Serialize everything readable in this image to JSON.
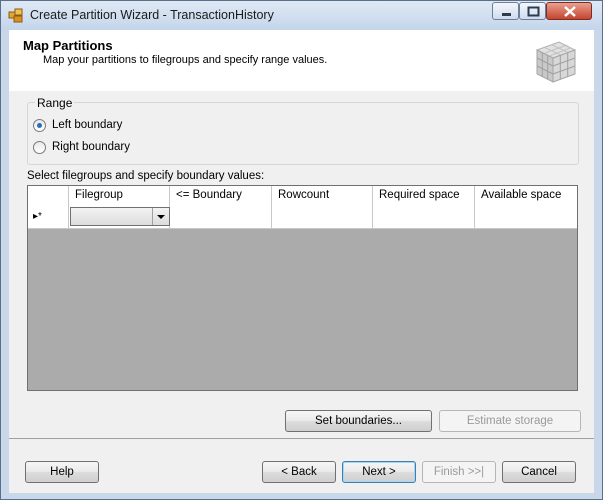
{
  "window": {
    "title": "Create Partition Wizard - TransactionHistory"
  },
  "header": {
    "title": "Map Partitions",
    "subtitle": "Map your partitions to filegroups and specify range values."
  },
  "range": {
    "label": "Range",
    "options": [
      {
        "label": "Left boundary",
        "selected": true
      },
      {
        "label": "Right boundary",
        "selected": false
      }
    ]
  },
  "grid": {
    "caption": "Select filegroups and specify boundary values:",
    "columns": [
      "Filegroup",
      "<= Boundary",
      "Rowcount",
      "Required space",
      "Available space"
    ],
    "new_row_indicator": "▸*"
  },
  "actions": {
    "set_boundaries": "Set boundaries...",
    "estimate_storage": "Estimate storage"
  },
  "footer": {
    "help": "Help",
    "back": "< Back",
    "next": "Next >",
    "finish": "Finish >>|",
    "cancel": "Cancel"
  }
}
